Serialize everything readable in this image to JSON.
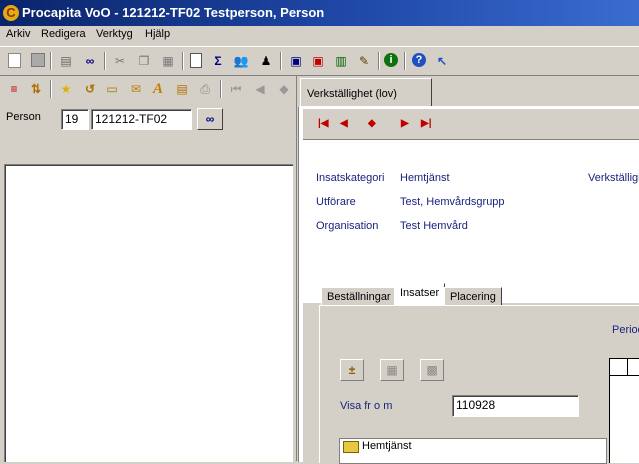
{
  "window": {
    "title": "Procapita VoO - 121212-TF02 Testperson, Person",
    "app_icon_letter": "C"
  },
  "menu": [
    "Arkiv",
    "Redigera",
    "Verktyg",
    "Hjälp"
  ],
  "toolbar1_icons": [
    "new-doc-icon",
    "save-icon",
    "print-icon",
    "find-icon",
    "cut-icon",
    "copy-icon",
    "paste-icon",
    "page-icon",
    "sum-icon",
    "people-icon",
    "person-icon",
    "form-icon",
    "form2-icon",
    "chart-icon",
    "wand-icon",
    "info-icon",
    "help-icon",
    "pointer-help-icon"
  ],
  "left": {
    "person_label": "Person",
    "person_number": "19",
    "person_id": "121212-TF02"
  },
  "right": {
    "main_tab": "Verkställighet (lov)",
    "info": {
      "insatskategori_label": "Insatskategori",
      "insatskategori_value": "Hemtjänst",
      "utforare_label": "Utförare",
      "utforare_value": "Test, Hemvårdsgrupp",
      "organisation_label": "Organisation",
      "organisation_value": "Test Hemvård",
      "verkstallighet_label": "Verkställighet"
    },
    "subtabs": [
      "Beställningar",
      "Insatser",
      "Placering"
    ],
    "period_label": "Period",
    "visa_label": "Visa fr o m",
    "visa_value": "110928",
    "tree_root": "Hemtjänst"
  }
}
